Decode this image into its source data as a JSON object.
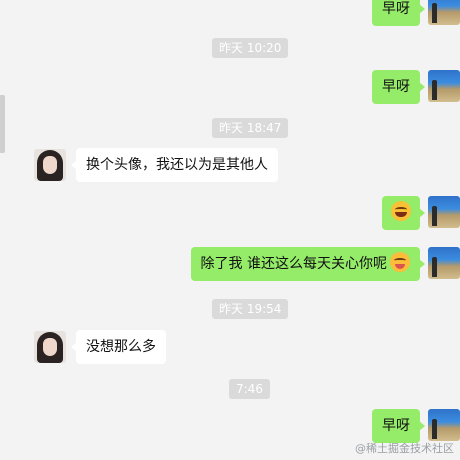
{
  "chat": {
    "timestamps": [
      "昨天 10:20",
      "昨天 18:47",
      "昨天 19:54",
      "7:46"
    ],
    "messages": [
      {
        "from": "self",
        "text": "早呀"
      },
      {
        "from": "self",
        "text": "早呀"
      },
      {
        "from": "other",
        "text": "换个头像，我还以为是其他人"
      },
      {
        "from": "self",
        "emoji": "laughing-tears"
      },
      {
        "from": "self",
        "text": "除了我 谁还这么每天关心你呢",
        "emoji": "drooling-face"
      },
      {
        "from": "other",
        "text": "没想那么多"
      },
      {
        "from": "self",
        "text": "早呀"
      }
    ]
  },
  "colors": {
    "background": "#f3f3f3",
    "self_bubble": "#95ec69",
    "other_bubble": "#ffffff",
    "timestamp_bg": "#dadada"
  },
  "watermark": "@稀土掘金技术社区"
}
